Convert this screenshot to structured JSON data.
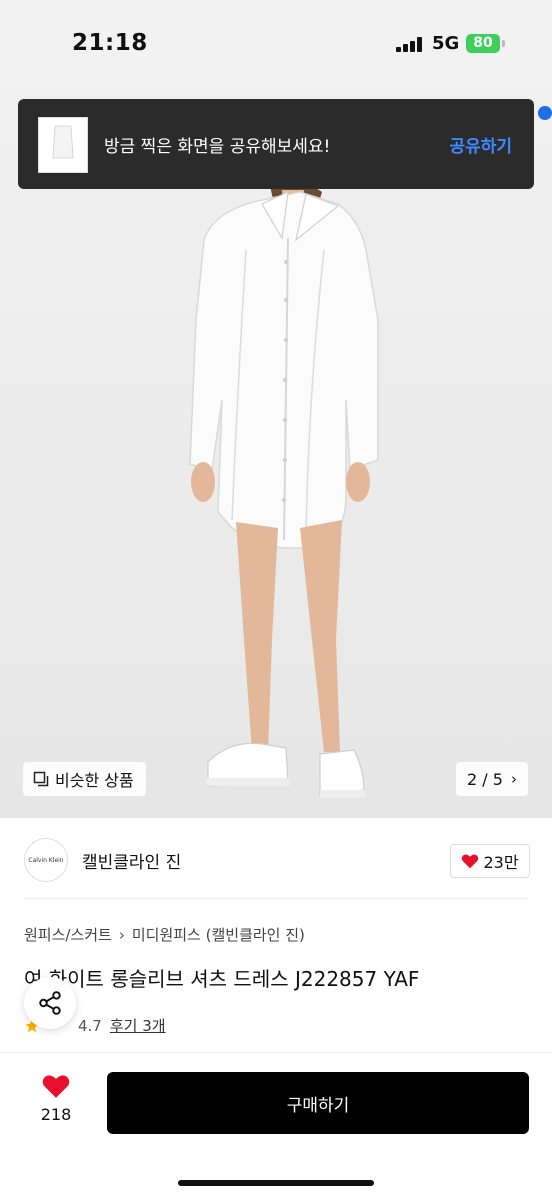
{
  "status_bar": {
    "time": "21:18",
    "network": "5G",
    "battery": "80"
  },
  "share_toast": {
    "message": "방금 찍은 화면을 공유해보세요!",
    "action": "공유하기"
  },
  "gallery": {
    "similar_label": "비슷한 상품",
    "page": "2 / 5",
    "page_current": 2,
    "page_total": 5
  },
  "brand": {
    "logo_text": "Calvin Klein",
    "name": "캘빈클라인 진",
    "likes": "23만"
  },
  "breadcrumb": {
    "category": "원피스/스커트",
    "subcategory": "미디원피스 (캘빈클라인 진)"
  },
  "product": {
    "title": "여 화이트 롱슬리브 셔츠 드레스 J222857 YAF",
    "rating": "4.7",
    "reviews": "후기 3개"
  },
  "bottom_bar": {
    "wish_count": "218",
    "buy_label": "구매하기"
  },
  "colors": {
    "accent": "#3b8bff",
    "buy_button": "#000000",
    "heart": "#e8112d",
    "battery": "#3ecf5a"
  },
  "icons": [
    "signal-icon",
    "battery-icon",
    "similar-icon",
    "chevron-right-icon",
    "heart-icon",
    "share-icon",
    "star-icon"
  ]
}
